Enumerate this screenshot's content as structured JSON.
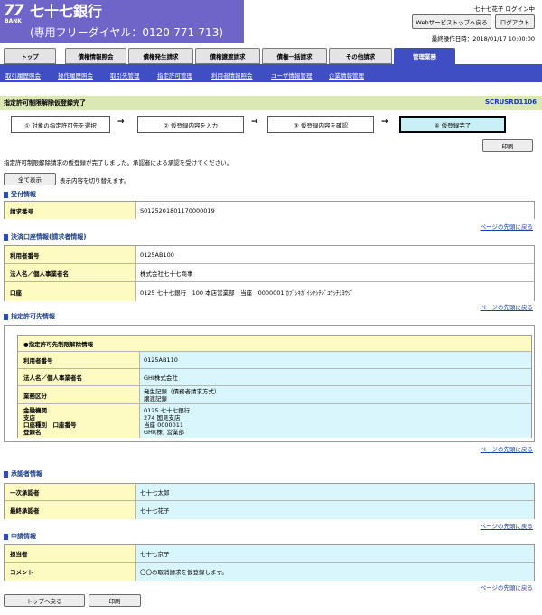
{
  "header": {
    "logo_number": "77",
    "logo_bank": "BANK",
    "bank_name": "七十七銀行",
    "toll_free": "(専用フリーダイヤル：0120-771-713)",
    "user_status": "七十七花子 ログイン中",
    "web_top_button": "Webサービストップへ戻る",
    "logout_button": "ログアウト",
    "last_operation": "最終操作日時：2018/01/17 10:00:00"
  },
  "tabs": [
    {
      "label": "トップ"
    },
    {
      "label": "債権情報照会"
    },
    {
      "label": "債権発生請求"
    },
    {
      "label": "債権譲渡請求"
    },
    {
      "label": "債権一括請求"
    },
    {
      "label": "その他請求"
    },
    {
      "label": "管理業務"
    }
  ],
  "subnav": [
    {
      "label": "取引履歴照会"
    },
    {
      "label": "操作履歴照会"
    },
    {
      "label": "取引先管理"
    },
    {
      "label": "指定許可管理"
    },
    {
      "label": "利用者情報照会"
    },
    {
      "label": "ユーザ情報管理"
    },
    {
      "label": "企業情報管理"
    }
  ],
  "page": {
    "title": "指定許可制限解除仮登録完了",
    "screen_id": "SCRUSRD1106"
  },
  "steps": [
    {
      "label": "① 対象の指定許可先を選択"
    },
    {
      "label": "② 仮登録内容を入力"
    },
    {
      "label": "③ 仮登録内容を確認"
    },
    {
      "label": "④ 仮登録完了"
    }
  ],
  "print_label": "印刷",
  "complete_message": "指定許可制限解除請求の仮登録が完了しました。承認者による承認を受けてください。",
  "show_all_button": "全て表示",
  "show_all_note": "表示内容を切り替えます。",
  "page_top_link": "ページの先頭に戻る",
  "reception": {
    "heading": "受付情報",
    "rows": [
      {
        "label": "請求番号",
        "value": "S0125201801170000019"
      }
    ]
  },
  "settlement": {
    "heading": "決済口座情報(請求者情報)",
    "rows": [
      {
        "label": "利用者番号",
        "value": "0125AB100"
      },
      {
        "label": "法人名／個人事業者名",
        "value": "株式会社七十七商事"
      },
      {
        "label": "口座",
        "value": "0125 七十七銀行　100 本店営業部　当座　0000001 ｶﾌﾞｼｷｶﾞｲｼﾔｼﾁｼﾞﾕｳｼﾁｼﾖｳｼﾞ"
      }
    ]
  },
  "permit": {
    "heading": "指定許可先情報",
    "inner_title": "●指定許可先制限解除情報",
    "user_number_label": "利用者番号",
    "user_number": "0125AB110",
    "corp_name_label": "法人名／個人事業者名",
    "corp_name": "GHI株式会社",
    "business_label": "業務区分",
    "business_lines": [
      "発生記録（債務者請求方式）",
      "譲渡記録"
    ],
    "account_labels": [
      "金融機関",
      "支店",
      "口座種別　口座番号",
      "登録名"
    ],
    "account_values": [
      "0125 七十七銀行",
      "274 国見支店",
      "当座 0000011",
      "GHI(株) 営業部"
    ]
  },
  "approver": {
    "heading": "承認者情報",
    "rows": [
      {
        "label": "一次承認者",
        "value": "七十七太郎"
      },
      {
        "label": "最終承認者",
        "value": "七十七花子"
      }
    ]
  },
  "application": {
    "heading": "申請情報",
    "rows": [
      {
        "label": "担当者",
        "value": "七十七京子"
      },
      {
        "label": "コメント",
        "value": "〇〇の取消請求を仮登録します。"
      }
    ]
  },
  "footer": {
    "top_button": "トップへ戻る",
    "print_button": "印刷"
  }
}
